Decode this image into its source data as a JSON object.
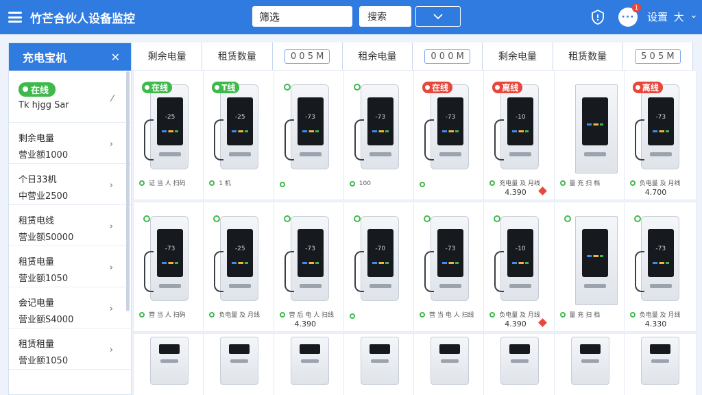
{
  "header": {
    "title": "竹芒合伙人设备监控",
    "filter_select": "筛选",
    "filter_input": "搜索",
    "user_name": "设置",
    "user_suffix": "大",
    "notif_count": "1"
  },
  "sidebar": {
    "title": "充电宝机",
    "first": {
      "tag": "在线",
      "text": "Tk hjgg Sar"
    },
    "items": [
      {
        "l1": "剩余电量",
        "l2": "营业额1000"
      },
      {
        "l1": "个日33机",
        "l2": "中营业2500"
      },
      {
        "l1": "租赁电线",
        "l2": "营业额S0000"
      },
      {
        "l1": "租赁电量",
        "l2": "营业额1050"
      },
      {
        "l1": "会记电量",
        "l2": "营业额S4000"
      },
      {
        "l1": "租赁租量",
        "l2": "营业额1050"
      }
    ]
  },
  "tabs": [
    {
      "label": "剩余电量"
    },
    {
      "label": "租赁数量"
    },
    {
      "label": "0 0 5 M"
    },
    {
      "label": "租余电量"
    },
    {
      "label": "0 0 0 M"
    },
    {
      "label": "剩余电量"
    },
    {
      "label": "租赁数量"
    },
    {
      "label": "5 0 5 M"
    }
  ],
  "row1": [
    {
      "badge": "在线",
      "color": "green",
      "screen": "-25",
      "foot": "证 当 人 扫码",
      "foot2": ""
    },
    {
      "badge": "T线",
      "color": "green",
      "screen": "-25",
      "foot": "1 机",
      "foot2": ""
    },
    {
      "badge": "",
      "color": "dot",
      "screen": "-73",
      "foot": "",
      "foot2": ""
    },
    {
      "badge": "",
      "color": "dot",
      "screen": "-73",
      "foot": "100",
      "foot2": ""
    },
    {
      "badge": "在线",
      "color": "red",
      "screen": "-73",
      "foot": "",
      "foot2": ""
    },
    {
      "badge": "离线",
      "color": "red",
      "screen": "-10",
      "foot": "充电量 及 月线",
      "foot2": "4.390"
    },
    {
      "badge": "",
      "color": "none",
      "screen": "",
      "foot": "量 充 扫 档",
      "foot2": ""
    },
    {
      "badge": "离线",
      "color": "red",
      "screen": "-73",
      "foot": "负电量 及 月线",
      "foot2": "4.700"
    }
  ],
  "row2": [
    {
      "screen": "-73",
      "foot": "营 当 人 扫码",
      "foot2": ""
    },
    {
      "screen": "-25",
      "foot": "负电量 及 月线",
      "foot2": ""
    },
    {
      "screen": "-73",
      "foot": "营 后 电 人 扫线",
      "foot2": "4.390"
    },
    {
      "screen": "-70",
      "foot": "",
      "foot2": ""
    },
    {
      "screen": "-73",
      "foot": "营 当 电 人 扫线",
      "foot2": ""
    },
    {
      "screen": "-10",
      "foot": "负电量 及 月线",
      "foot2": "4.390"
    },
    {
      "screen": "",
      "foot": "量 充 扫 档",
      "foot2": ""
    },
    {
      "screen": "-73",
      "foot": "负电量 及 月线",
      "foot2": "4.330"
    }
  ],
  "icons": {
    "menu": "menu-icon",
    "shield": "shield-icon",
    "chat": "chat-icon",
    "close": "close-icon",
    "chevron": "chevron-right-icon"
  },
  "colors": {
    "primary": "#2f7be0",
    "online": "#3fb94b",
    "offline": "#e8483c"
  }
}
